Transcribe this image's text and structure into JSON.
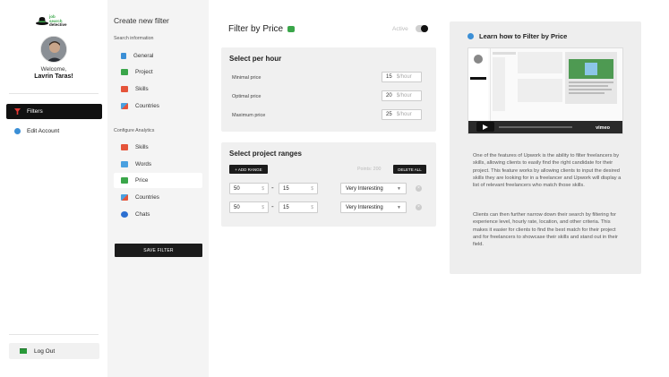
{
  "brand": {
    "logo_line1": "job",
    "logo_line2": "search",
    "logo_line3": "detective"
  },
  "user": {
    "welcome": "Welcome,",
    "name": "Lavrin Taras!"
  },
  "sidebar": {
    "items": [
      {
        "label": "Filters",
        "icon": "filter-icon",
        "active": true
      },
      {
        "label": "Edit Account",
        "icon": "globe-icon",
        "active": false
      }
    ],
    "logout_label": "Log Out"
  },
  "filters_panel": {
    "title": "Create new filter",
    "search_section": "Search information",
    "search_items": [
      "General",
      "Project",
      "Skills",
      "Countries"
    ],
    "analytics_section": "Configure Analytics",
    "analytics_items": [
      "Skills",
      "Words",
      "Price",
      "Countries",
      "Chats"
    ],
    "active_item": "Price",
    "save_label": "SAVE FILTER"
  },
  "main": {
    "title": "Filter by Price",
    "active_label": "Active",
    "active_on": true,
    "per_hour": {
      "title": "Select per hour",
      "rows": [
        {
          "label": "Minimal price",
          "value": "15",
          "unit": "$/hour"
        },
        {
          "label": "Optimal price",
          "value": "20",
          "unit": "$/hour"
        },
        {
          "label": "Maximum price",
          "value": "25",
          "unit": "$/hour"
        }
      ]
    },
    "ranges": {
      "title": "Select project ranges",
      "add_label": "+ ADD RANGE",
      "points_label": "Points: 200",
      "delete_label": "DELETE ALL",
      "rows": [
        {
          "from": "50",
          "to": "15",
          "unit": "$",
          "level": "Very Interesting"
        },
        {
          "from": "50",
          "to": "15",
          "unit": "$",
          "level": "Very Interesting"
        }
      ]
    }
  },
  "learn": {
    "title": "Learn how to Filter by Price",
    "video_brand": "vimeo",
    "paragraph1": "One of the features of Upwork is the ability to filter freelancers by skills, allowing clients to easily find the right candidate for their project. This feature works by allowing clients to input the desired skills they are looking for in a freelancer and Upwork will display a list of relevant freelancers who match those skills.",
    "paragraph2": "Clients can then further narrow down their search by filtering for experience level, hourly rate, location, and other criteria. This makes it easier for clients to find the best match for their project and for freelancers to showcase their skills and stand out in their field."
  },
  "colors": {
    "accent_dark": "#1b1b1b",
    "accent_green": "#3aa64a",
    "active_nav": "#111111"
  }
}
